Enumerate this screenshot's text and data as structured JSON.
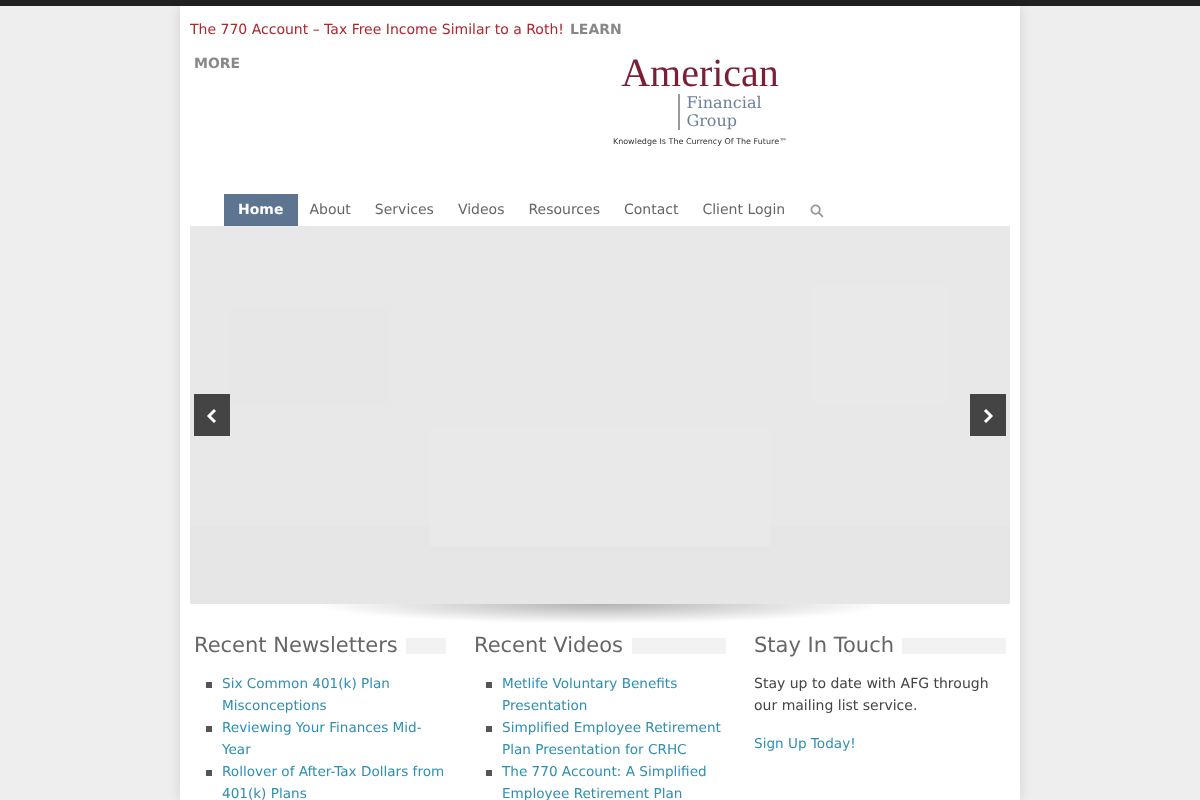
{
  "ticker": {
    "text": "The 770 Account – Tax Free Income Similar to a Roth!",
    "link_parts": [
      "LEARN",
      "MORE"
    ]
  },
  "logo": {
    "name": "American",
    "line2": "Financial",
    "line3": "Group",
    "tagline": "Knowledge Is The Currency Of The Future™"
  },
  "nav": [
    {
      "label": "Home",
      "selected": true
    },
    {
      "label": "About",
      "selected": false
    },
    {
      "label": "Services",
      "selected": false
    },
    {
      "label": "Videos",
      "selected": false
    },
    {
      "label": "Resources",
      "selected": false
    },
    {
      "label": "Contact",
      "selected": false
    },
    {
      "label": "Client Login",
      "selected": false
    }
  ],
  "widgets": [
    {
      "title": "Recent Newsletters",
      "kind": "list",
      "links": [
        "Six Common 401(k) Plan Misconceptions",
        "Reviewing Your Finances Mid-Year",
        "Rollover of After-Tax Dollars from 401(k) Plans"
      ]
    },
    {
      "title": "Recent Videos",
      "kind": "list",
      "links": [
        "Metlife Voluntary Benefits Presentation",
        "Simplified Employee Retirement Plan Presentation for CRHC",
        "The 770 Account: A Simplified Employee Retirement Plan"
      ]
    },
    {
      "title": "Stay In Touch",
      "kind": "text",
      "text": "Stay up to date with AFG through our mailing list service.",
      "link": "Sign Up Today!"
    }
  ]
}
